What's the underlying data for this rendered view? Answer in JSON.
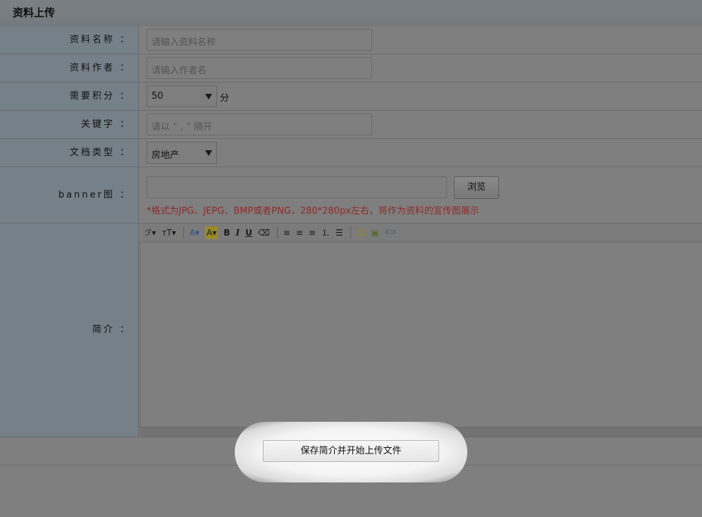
{
  "header": {
    "title": "资料上传"
  },
  "form": {
    "name": {
      "label": "资料名称 ：",
      "placeholder": "请输入资料名称"
    },
    "author": {
      "label": "资料作者 ：",
      "placeholder": "请输入作者名"
    },
    "points": {
      "label": "需要积分 ：",
      "value": "50",
      "unit": "分"
    },
    "keywords": {
      "label": "关键字 ：",
      "placeholder": "请以 “ , ” 隔开"
    },
    "doctype": {
      "label": "文档类型 ：",
      "value": "房地产"
    },
    "banner": {
      "label": "banner图 ：",
      "browse_label": "浏览",
      "hint": "*格式为JPG、JEPG、BMP或者PNG，280*280px左右，将作为资料的宣传图展示"
    },
    "intro": {
      "label": "简介 ：",
      "toolbar": {
        "font": "ℱ▾",
        "size": "ᴛT▾",
        "forecolor": "A▾",
        "backcolor": "A▾",
        "bold": "B",
        "italic": "I",
        "underline": "U",
        "eraser": "⌫",
        "align_left": "≡",
        "align_center": "≡",
        "align_right": "≡",
        "ordered_list": "⒈",
        "unordered_list": "☰",
        "emoji": "☺",
        "image": "▣",
        "link": "⊂⊃"
      }
    }
  },
  "submit": {
    "label": "保存简介并开始上传文件"
  }
}
